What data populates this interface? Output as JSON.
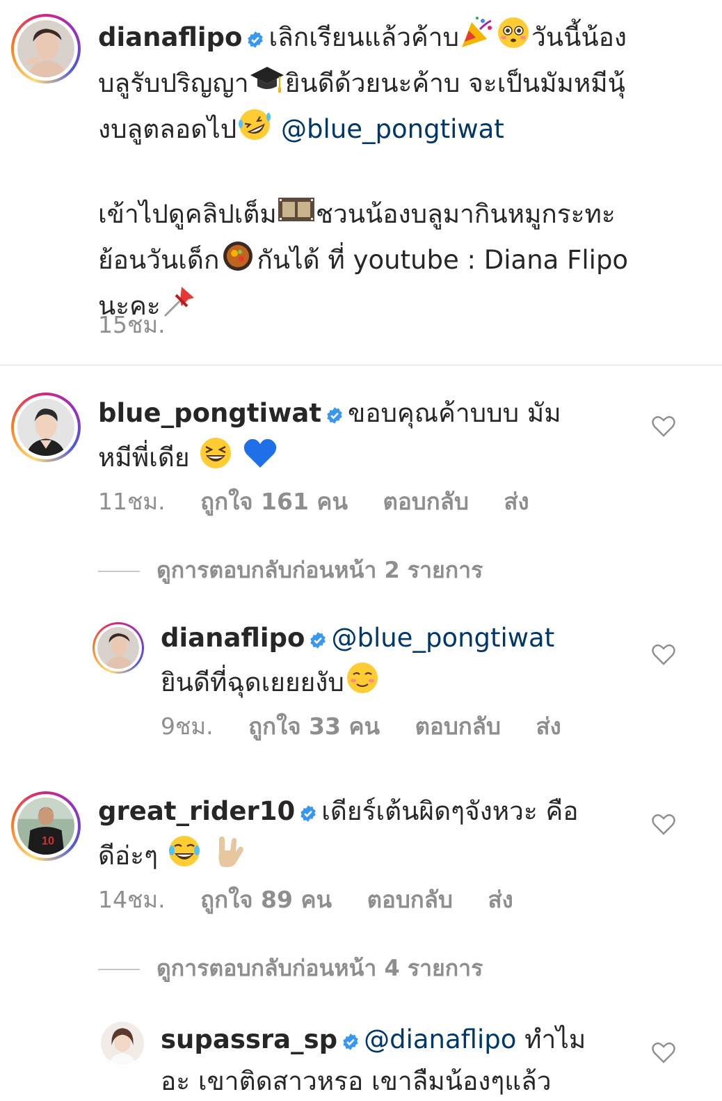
{
  "caption": {
    "username": "dianaflipo",
    "line1_text": "เลิกเรียนแล้วค้าบ",
    "line1_text2": "วันนี้น้อง",
    "line2_text": "บลูรับปริญญา",
    "line2_text2": "ยินดีด้วยนะค้าบ จะเป็นมัมหมีนุ้",
    "line3_text": "งบลูตลอดไป",
    "mention": "@blue_pongtiwat",
    "para2_line1a": "เข้าไปดูคลิปเต็ม",
    "para2_line1b": "ชวนน้องบลูมากินหมูกระทะ",
    "para2_line2a": "ย้อนวันเด็ก",
    "para2_line2b": "กันได้ ที่ youtube : Diana Flipo",
    "para2_line3": "นะคะ",
    "time": "15ชม."
  },
  "comments": [
    {
      "username": "blue_pongtiwat",
      "text1": "ขอบคุณค้าบบบ มัม",
      "text2": "หมีพี่เดีย",
      "time": "11ชม.",
      "likes": "ถูกใจ 161 คน",
      "reply": "ตอบกลับ",
      "send": "ส่ง",
      "view_replies": "ดูการตอบกลับก่อนหน้า 2 รายการ"
    },
    {
      "username": "dianaflipo",
      "mention": "@blue_pongtiwat",
      "text1": "ยินดีที่ฉุดเยยยงับ",
      "time": "9ชม.",
      "likes": "ถูกใจ 33 คน",
      "reply": "ตอบกลับ",
      "send": "ส่ง"
    },
    {
      "username": "great_rider10",
      "text1": "เดียร์เต้นผิดๆจังหวะ คือ",
      "text2": "ดีอ่ะๆ",
      "time": "14ชม.",
      "likes": "ถูกใจ 89 คน",
      "reply": "ตอบกลับ",
      "send": "ส่ง",
      "view_replies": "ดูการตอบกลับก่อนหน้า 4 รายการ"
    },
    {
      "username": "supassra_sp",
      "mention": "@dianaflipo",
      "text1": "ทำไม",
      "text2": "อะ เขาติดสาวหรอ เขาลืมน้องๆแล้ว"
    }
  ],
  "icons": {
    "verified": "verified-badge-icon",
    "heart": "heart-outline-icon"
  },
  "colors": {
    "verified": "#3897f0",
    "mention": "#00376b",
    "muted": "#8e8e8e"
  }
}
